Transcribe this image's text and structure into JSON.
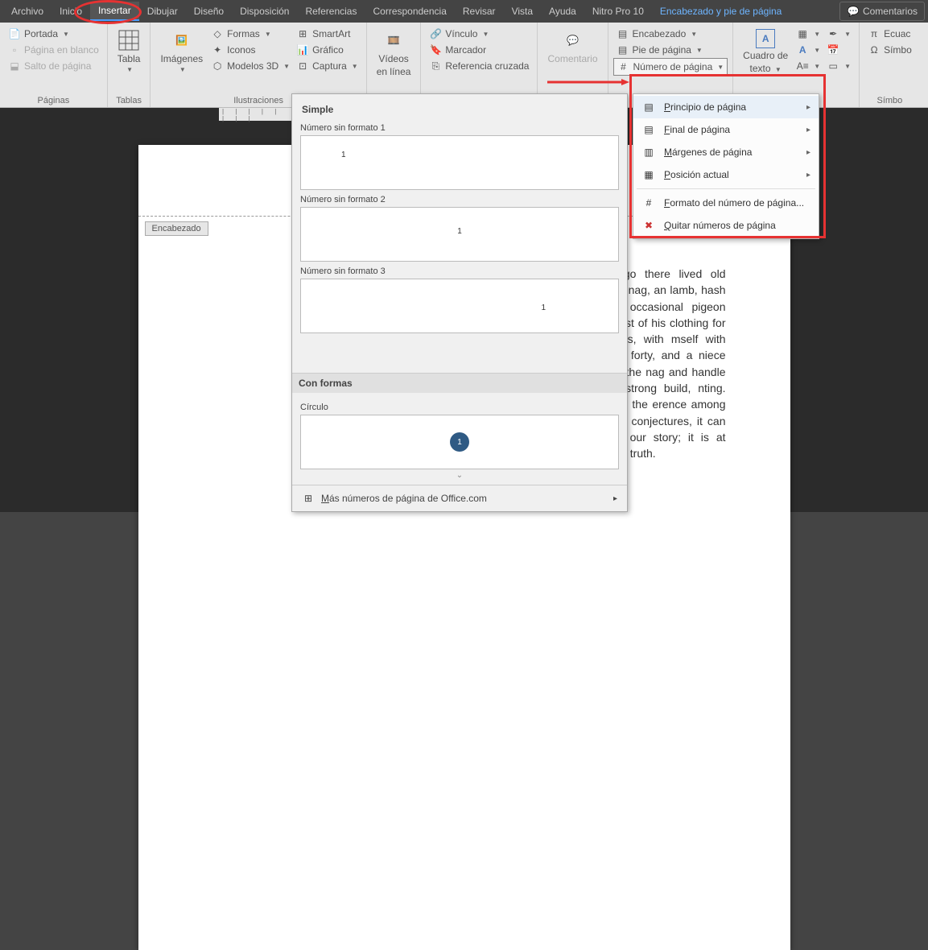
{
  "menubar": {
    "items": [
      {
        "label": "Archivo"
      },
      {
        "label": "Inicio"
      },
      {
        "label": "Insertar",
        "selected": true
      },
      {
        "label": "Dibujar"
      },
      {
        "label": "Diseño"
      },
      {
        "label": "Disposición"
      },
      {
        "label": "Referencias"
      },
      {
        "label": "Correspondencia"
      },
      {
        "label": "Revisar"
      },
      {
        "label": "Vista"
      },
      {
        "label": "Ayuda"
      },
      {
        "label": "Nitro Pro 10"
      },
      {
        "label": "Encabezado y pie de página",
        "contextual": true
      }
    ],
    "comments": "Comentarios"
  },
  "ribbon": {
    "paginas": {
      "label": "Páginas",
      "portada": "Portada",
      "blanco": "Página en blanco",
      "salto": "Salto de página"
    },
    "tablas": {
      "label": "Tablas",
      "tabla": "Tabla"
    },
    "ilustraciones": {
      "label": "Ilustraciones",
      "imagenes": "Imágenes",
      "formas": "Formas",
      "iconos": "Iconos",
      "modelos3d": "Modelos 3D",
      "smartart": "SmartArt",
      "grafico": "Gráfico",
      "captura": "Captura"
    },
    "videos": {
      "line1": "Vídeos",
      "line2": "en línea"
    },
    "vinculos": {
      "vinculo": "Vínculo",
      "marcador": "Marcador",
      "ref": "Referencia cruzada"
    },
    "comentario": "Comentario",
    "encabezados": {
      "encabezado": "Encabezado",
      "pie": "Pie de página",
      "numero": "Número de página"
    },
    "texto": {
      "line1": "Cuadro de",
      "line2": "texto"
    },
    "simbolos": {
      "label": "Símbo",
      "ecuac": "Ecuac",
      "simbo": "Símbo"
    }
  },
  "gallery": {
    "simple": "Simple",
    "nf1": "Número sin formato 1",
    "nf2": "Número sin formato 2",
    "nf3": "Número sin formato 3",
    "conformas": "Con formas",
    "circulo": "Círculo",
    "more": "Más números de página de Office.com",
    "one": "1"
  },
  "submenu": {
    "principio": "Principio de página",
    "final": "Final de página",
    "margenes": "Márgenes de página",
    "posicion": "Posición actual",
    "formato": "Formato del número de página...",
    "quitar": "Quitar números de página"
  },
  "page": {
    "header_label": "Encabezado",
    "body": "all, not long ago there lived old buckler, a skinny nag, an lamb, hash most nights, n occasional pigeon added te. The rest of his clothing for special occasions, with mself with his finest velour forty, and a niece who had saddle the nag and handle ars; he had a strong build, nting. They say he had the erence among the authors sible conjectures, it can be ters little to our story; it is at deviates from the truth."
  }
}
